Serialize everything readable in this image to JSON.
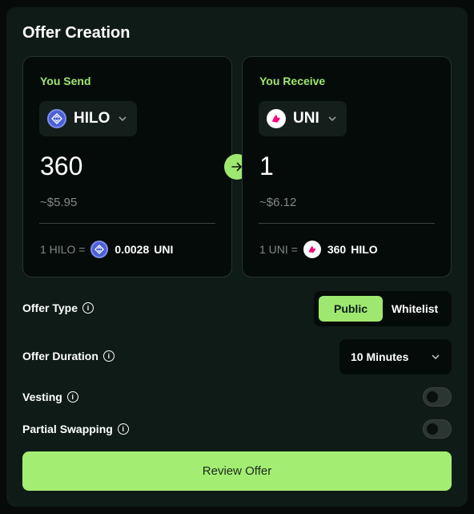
{
  "title": "Offer Creation",
  "send": {
    "label": "You Send",
    "token": "HILO",
    "amount": "360",
    "usd": "~$5.95",
    "rate_lhs": "1 HILO =",
    "rate_value": "0.0028",
    "rate_token": "UNI",
    "token_icon": "hilo-token-icon"
  },
  "receive": {
    "label": "You Receive",
    "token": "UNI",
    "amount": "1",
    "usd": "~$6.12",
    "rate_lhs": "1 UNI =",
    "rate_value": "360",
    "rate_token": "HILO",
    "token_icon": "uni-token-icon"
  },
  "swap_icon": "arrow-right-icon",
  "offer_type": {
    "label": "Offer Type",
    "options": [
      "Public",
      "Whitelist"
    ],
    "selected": "Public"
  },
  "offer_duration": {
    "label": "Offer Duration",
    "value": "10 Minutes"
  },
  "vesting": {
    "label": "Vesting",
    "enabled": false
  },
  "partial_swapping": {
    "label": "Partial Swapping",
    "enabled": false
  },
  "review_button": "Review Offer",
  "colors": {
    "accent": "#9fe870",
    "panel": "#0f1b17",
    "card": "#050b09",
    "hilo": "#4b5fd6",
    "uni": "#ff007a"
  }
}
